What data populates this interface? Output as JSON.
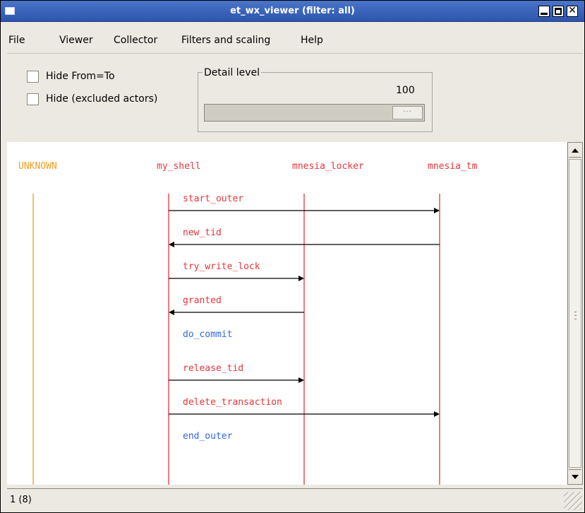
{
  "window": {
    "title": "et_wx_viewer (filter: all)"
  },
  "menu": [
    {
      "id": "file",
      "label": "File"
    },
    {
      "id": "viewer",
      "label": "Viewer"
    },
    {
      "id": "collector",
      "label": "Collector"
    },
    {
      "id": "filters",
      "label": "Filters and scaling"
    },
    {
      "id": "help",
      "label": "Help"
    }
  ],
  "options": {
    "hide_from_to": {
      "label": "Hide From=To",
      "checked": false
    },
    "hide_excluded": {
      "label": "Hide (excluded actors)",
      "checked": false
    }
  },
  "detail": {
    "legend": "Detail level",
    "value": "100",
    "slider_position": 1.0,
    "thumb_glyph": "···"
  },
  "actors": [
    {
      "name": "UNKNOWN",
      "color": "#f39c24"
    },
    {
      "name": "my_shell",
      "color": "#e8343b"
    },
    {
      "name": "mnesia_locker",
      "color": "#e8343b"
    },
    {
      "name": "mnesia_tm",
      "color": "#e8343b"
    }
  ],
  "events": [
    {
      "label": "start_outer",
      "from": 1,
      "to": 3,
      "color": "#e8343b"
    },
    {
      "label": "new_tid",
      "from": 3,
      "to": 1,
      "color": "#e8343b"
    },
    {
      "label": "try_write_lock",
      "from": 1,
      "to": 2,
      "color": "#e8343b"
    },
    {
      "label": "granted",
      "from": 2,
      "to": 1,
      "color": "#e8343b"
    },
    {
      "label": "do_commit",
      "from": 1,
      "to": 1,
      "color": "#3366e0"
    },
    {
      "label": "release_tid",
      "from": 1,
      "to": 2,
      "color": "#e8343b"
    },
    {
      "label": "delete_transaction",
      "from": 1,
      "to": 3,
      "color": "#e8343b"
    },
    {
      "label": "end_outer",
      "from": 1,
      "to": 1,
      "color": "#3366e0"
    }
  ],
  "status": {
    "text": "1 (8)"
  },
  "colors": {
    "arrow": "#000000",
    "title_bar": "#2c55ad"
  }
}
